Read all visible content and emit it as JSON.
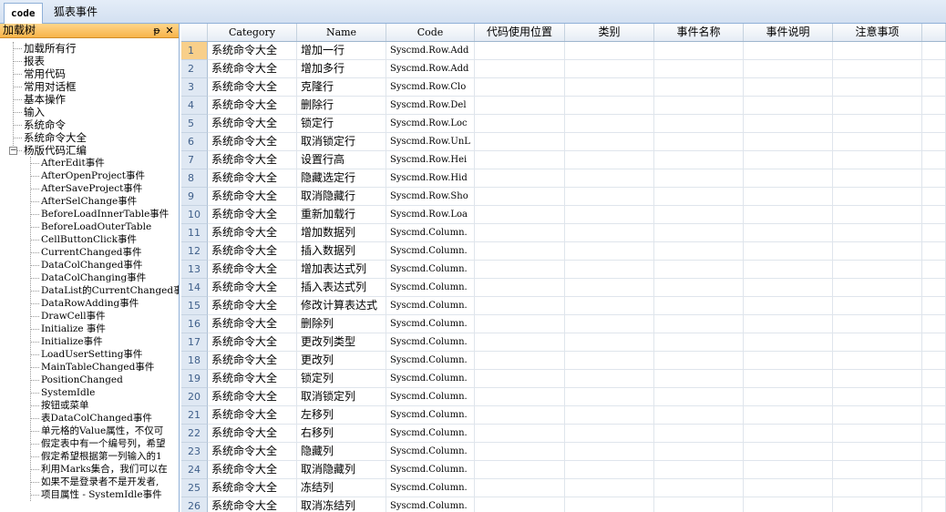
{
  "tabs": [
    {
      "label": "code",
      "active": true
    },
    {
      "label": "狐表事件",
      "active": false
    }
  ],
  "tree_panel": {
    "title": "加载树",
    "pin_glyph": "ᵽ",
    "close_glyph": "✕"
  },
  "tree": {
    "root_items": [
      "加载所有行",
      "报表",
      "常用代码",
      "常用对话框",
      "基本操作",
      "输入",
      "系统命令",
      "系统命令大全",
      "杨版代码汇编"
    ],
    "child_items": [
      "AfterEdit事件",
      "AfterOpenProject事件",
      "AfterSaveProject事件",
      "AfterSelChange事件",
      "BeforeLoadInnerTable事件",
      "BeforeLoadOuterTable",
      "CellButtonClick事件",
      "CurrentChanged事件",
      "DataColChanged事件",
      "DataColChanging事件",
      "DataList的CurrentChanged事",
      "DataRowAdding事件",
      "DrawCell事件",
      "Initialize 事件",
      "Initialize事件",
      "LoadUserSetting事件",
      "MainTableChanged事件",
      "PositionChanged",
      "SystemIdle",
      "按钮或菜单",
      "表DataColChanged事件",
      "单元格的Value属性，不仅可",
      "假定表中有一个编号列，希望",
      "假定希望根据第一列输入的1",
      "利用Marks集合，我们可以在",
      "如果不是登录者不是开发者,",
      "项目属性 - SystemIdle事件"
    ],
    "expander_glyph": "−"
  },
  "grid": {
    "columns": [
      "",
      "Category",
      "Name",
      "Code",
      "代码使用位置",
      "类别",
      "事件名称",
      "事件说明",
      "注意事项",
      ""
    ],
    "rows": [
      [
        "1",
        "系统命令大全",
        "增加一行",
        "Syscmd.Row.Add"
      ],
      [
        "2",
        "系统命令大全",
        "增加多行",
        "Syscmd.Row.Add"
      ],
      [
        "3",
        "系统命令大全",
        "克隆行",
        "Syscmd.Row.Clo"
      ],
      [
        "4",
        "系统命令大全",
        "删除行",
        "Syscmd.Row.Del"
      ],
      [
        "5",
        "系统命令大全",
        "锁定行",
        "Syscmd.Row.Loc"
      ],
      [
        "6",
        "系统命令大全",
        "取消锁定行",
        "Syscmd.Row.UnL"
      ],
      [
        "7",
        "系统命令大全",
        "设置行高",
        "Syscmd.Row.Hei"
      ],
      [
        "8",
        "系统命令大全",
        "隐藏选定行",
        "Syscmd.Row.Hid"
      ],
      [
        "9",
        "系统命令大全",
        "取消隐藏行",
        "Syscmd.Row.Sho"
      ],
      [
        "10",
        "系统命令大全",
        "重新加载行",
        "Syscmd.Row.Loa"
      ],
      [
        "11",
        "系统命令大全",
        "增加数据列",
        "Syscmd.Column."
      ],
      [
        "12",
        "系统命令大全",
        "插入数据列",
        "Syscmd.Column."
      ],
      [
        "13",
        "系统命令大全",
        "增加表达式列",
        "Syscmd.Column."
      ],
      [
        "14",
        "系统命令大全",
        "插入表达式列",
        "Syscmd.Column."
      ],
      [
        "15",
        "系统命令大全",
        "修改计算表达式",
        "Syscmd.Column."
      ],
      [
        "16",
        "系统命令大全",
        "删除列",
        "Syscmd.Column."
      ],
      [
        "17",
        "系统命令大全",
        "更改列类型",
        "Syscmd.Column."
      ],
      [
        "18",
        "系统命令大全",
        "更改列",
        "Syscmd.Column."
      ],
      [
        "19",
        "系统命令大全",
        "锁定列",
        "Syscmd.Column."
      ],
      [
        "20",
        "系统命令大全",
        "取消锁定列",
        "Syscmd.Column."
      ],
      [
        "21",
        "系统命令大全",
        "左移列",
        "Syscmd.Column."
      ],
      [
        "22",
        "系统命令大全",
        "右移列",
        "Syscmd.Column."
      ],
      [
        "23",
        "系统命令大全",
        "隐藏列",
        "Syscmd.Column."
      ],
      [
        "24",
        "系统命令大全",
        "取消隐藏列",
        "Syscmd.Column."
      ],
      [
        "25",
        "系统命令大全",
        "冻结列",
        "Syscmd.Column."
      ],
      [
        "26",
        "系统命令大全",
        "取消冻结列",
        "Syscmd.Column."
      ]
    ],
    "selected_row_number": "1"
  }
}
